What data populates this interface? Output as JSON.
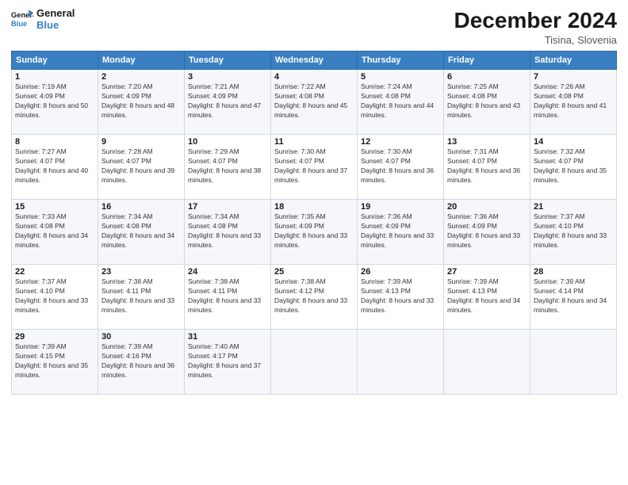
{
  "logo": {
    "line1": "General",
    "line2": "Blue"
  },
  "title": "December 2024",
  "subtitle": "Tisina, Slovenia",
  "days_header": [
    "Sunday",
    "Monday",
    "Tuesday",
    "Wednesday",
    "Thursday",
    "Friday",
    "Saturday"
  ],
  "weeks": [
    [
      {
        "day": 1,
        "sunrise": "7:19 AM",
        "sunset": "4:09 PM",
        "daylight": "8 hours and 50 minutes."
      },
      {
        "day": 2,
        "sunrise": "7:20 AM",
        "sunset": "4:09 PM",
        "daylight": "8 hours and 48 minutes."
      },
      {
        "day": 3,
        "sunrise": "7:21 AM",
        "sunset": "4:09 PM",
        "daylight": "8 hours and 47 minutes."
      },
      {
        "day": 4,
        "sunrise": "7:22 AM",
        "sunset": "4:08 PM",
        "daylight": "8 hours and 45 minutes."
      },
      {
        "day": 5,
        "sunrise": "7:24 AM",
        "sunset": "4:08 PM",
        "daylight": "8 hours and 44 minutes."
      },
      {
        "day": 6,
        "sunrise": "7:25 AM",
        "sunset": "4:08 PM",
        "daylight": "8 hours and 43 minutes."
      },
      {
        "day": 7,
        "sunrise": "7:26 AM",
        "sunset": "4:08 PM",
        "daylight": "8 hours and 41 minutes."
      }
    ],
    [
      {
        "day": 8,
        "sunrise": "7:27 AM",
        "sunset": "4:07 PM",
        "daylight": "8 hours and 40 minutes."
      },
      {
        "day": 9,
        "sunrise": "7:28 AM",
        "sunset": "4:07 PM",
        "daylight": "8 hours and 39 minutes."
      },
      {
        "day": 10,
        "sunrise": "7:29 AM",
        "sunset": "4:07 PM",
        "daylight": "8 hours and 38 minutes."
      },
      {
        "day": 11,
        "sunrise": "7:30 AM",
        "sunset": "4:07 PM",
        "daylight": "8 hours and 37 minutes."
      },
      {
        "day": 12,
        "sunrise": "7:30 AM",
        "sunset": "4:07 PM",
        "daylight": "8 hours and 36 minutes."
      },
      {
        "day": 13,
        "sunrise": "7:31 AM",
        "sunset": "4:07 PM",
        "daylight": "8 hours and 36 minutes."
      },
      {
        "day": 14,
        "sunrise": "7:32 AM",
        "sunset": "4:07 PM",
        "daylight": "8 hours and 35 minutes."
      }
    ],
    [
      {
        "day": 15,
        "sunrise": "7:33 AM",
        "sunset": "4:08 PM",
        "daylight": "8 hours and 34 minutes."
      },
      {
        "day": 16,
        "sunrise": "7:34 AM",
        "sunset": "4:08 PM",
        "daylight": "8 hours and 34 minutes."
      },
      {
        "day": 17,
        "sunrise": "7:34 AM",
        "sunset": "4:08 PM",
        "daylight": "8 hours and 33 minutes."
      },
      {
        "day": 18,
        "sunrise": "7:35 AM",
        "sunset": "4:09 PM",
        "daylight": "8 hours and 33 minutes."
      },
      {
        "day": 19,
        "sunrise": "7:36 AM",
        "sunset": "4:09 PM",
        "daylight": "8 hours and 33 minutes."
      },
      {
        "day": 20,
        "sunrise": "7:36 AM",
        "sunset": "4:09 PM",
        "daylight": "8 hours and 33 minutes."
      },
      {
        "day": 21,
        "sunrise": "7:37 AM",
        "sunset": "4:10 PM",
        "daylight": "8 hours and 33 minutes."
      }
    ],
    [
      {
        "day": 22,
        "sunrise": "7:37 AM",
        "sunset": "4:10 PM",
        "daylight": "8 hours and 33 minutes."
      },
      {
        "day": 23,
        "sunrise": "7:38 AM",
        "sunset": "4:11 PM",
        "daylight": "8 hours and 33 minutes."
      },
      {
        "day": 24,
        "sunrise": "7:38 AM",
        "sunset": "4:11 PM",
        "daylight": "8 hours and 33 minutes."
      },
      {
        "day": 25,
        "sunrise": "7:38 AM",
        "sunset": "4:12 PM",
        "daylight": "8 hours and 33 minutes."
      },
      {
        "day": 26,
        "sunrise": "7:39 AM",
        "sunset": "4:13 PM",
        "daylight": "8 hours and 33 minutes."
      },
      {
        "day": 27,
        "sunrise": "7:39 AM",
        "sunset": "4:13 PM",
        "daylight": "8 hours and 34 minutes."
      },
      {
        "day": 28,
        "sunrise": "7:39 AM",
        "sunset": "4:14 PM",
        "daylight": "8 hours and 34 minutes."
      }
    ],
    [
      {
        "day": 29,
        "sunrise": "7:39 AM",
        "sunset": "4:15 PM",
        "daylight": "8 hours and 35 minutes."
      },
      {
        "day": 30,
        "sunrise": "7:39 AM",
        "sunset": "4:16 PM",
        "daylight": "8 hours and 36 minutes."
      },
      {
        "day": 31,
        "sunrise": "7:40 AM",
        "sunset": "4:17 PM",
        "daylight": "8 hours and 37 minutes."
      },
      null,
      null,
      null,
      null
    ]
  ],
  "labels": {
    "sunrise": "Sunrise:",
    "sunset": "Sunset:",
    "daylight": "Daylight:"
  }
}
